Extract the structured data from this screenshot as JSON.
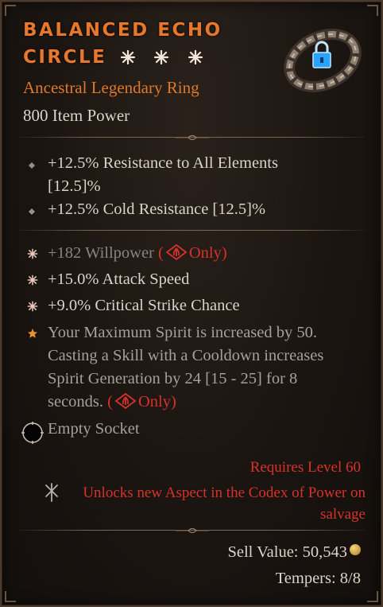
{
  "item": {
    "name": "BALANCED ECHO CIRCLE",
    "type": "Ancestral Legendary Ring",
    "item_power": "800 Item Power",
    "greater_affix_count": 3
  },
  "implicits": [
    {
      "line1": "+12.5% Resistance to All Elements",
      "line2": "[12.5]%"
    },
    {
      "line1": "+12.5% Cold Resistance [12.5]%"
    }
  ],
  "affixes": {
    "willpower": {
      "text": "+182 Willpower",
      "restriction_open": "(",
      "restriction_label": "Only)"
    },
    "attack_speed": "+15.0% Attack Speed",
    "crit_chance": "+9.0% Critical Strike Chance"
  },
  "aspect": {
    "line1": "Your Maximum Spirit is increased by 50.",
    "line2": "Casting a Skill with a Cooldown increases",
    "line3": "Spirit Generation by 24 [15 - 25] for 8",
    "line4": "seconds.",
    "restriction_open": "(",
    "restriction_label": "Only)"
  },
  "socket": {
    "label": "Empty Socket"
  },
  "requirements": {
    "level": "Requires Level 60"
  },
  "codex": {
    "line1": "Unlocks new Aspect in the Codex of Power on",
    "line2": "salvage"
  },
  "footer": {
    "sell_label": "Sell Value:",
    "sell_value": "50,543",
    "tempers": "Tempers: 8/8"
  },
  "colors": {
    "legendary": "#e6772b",
    "restriction": "#d7322a",
    "text": "#dcd4c8",
    "dim": "#8b847b"
  },
  "icons": [
    "greater-affix-star-icon",
    "ring-item-icon",
    "lock-icon",
    "spiritborn-class-icon",
    "unique-aspect-star-icon",
    "empty-socket-icon",
    "codex-icon",
    "gold-coin-icon"
  ]
}
